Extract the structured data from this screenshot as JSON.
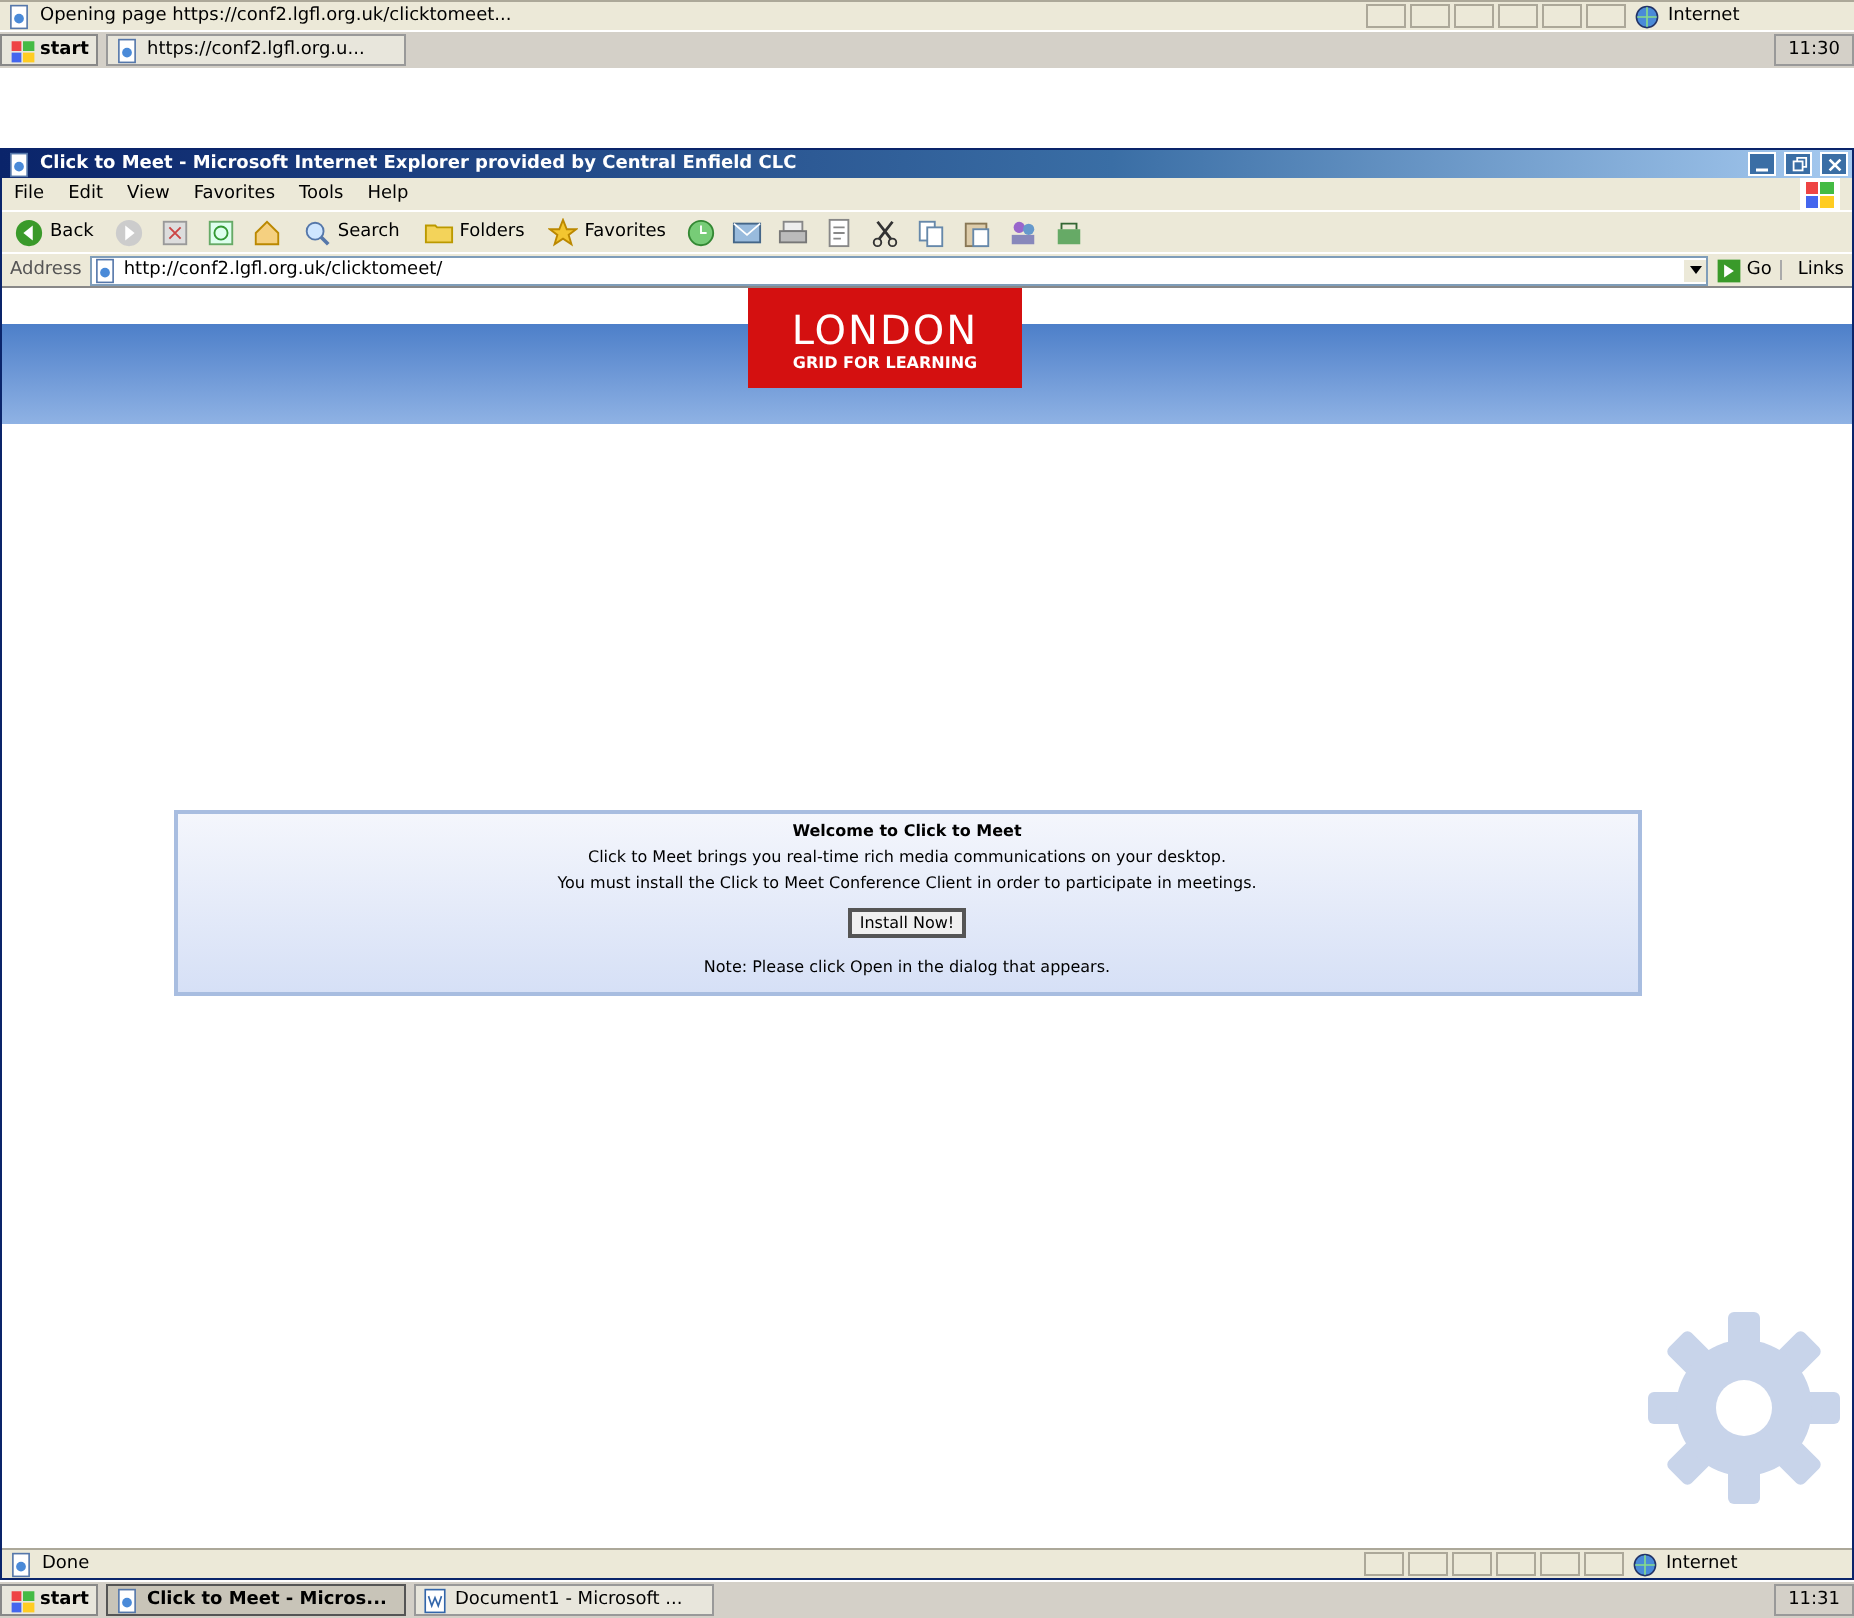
{
  "background_window": {
    "status_text": "Opening page https://conf2.lgfl.org.uk/clicktomeet...",
    "zone": "Internet",
    "taskbar": {
      "start": "start",
      "tasks": [
        {
          "label": "https://conf2.lgfl.org.u...",
          "selected": false
        }
      ],
      "clock": "11:30"
    }
  },
  "window": {
    "title": "Click to Meet - Microsoft Internet Explorer provided by Central Enfield CLC"
  },
  "menu": [
    "File",
    "Edit",
    "View",
    "Favorites",
    "Tools",
    "Help"
  ],
  "toolbar": [
    {
      "kind": "labeled",
      "label": "Back"
    },
    {
      "kind": "icon"
    },
    {
      "kind": "icon"
    },
    {
      "kind": "icon"
    },
    {
      "kind": "icon"
    },
    {
      "kind": "labeled",
      "label": "Search"
    },
    {
      "kind": "labeled",
      "label": "Folders"
    },
    {
      "kind": "labeled",
      "label": "Favorites"
    },
    {
      "kind": "icon"
    },
    {
      "kind": "icon"
    },
    {
      "kind": "icon"
    },
    {
      "kind": "icon"
    },
    {
      "kind": "icon"
    },
    {
      "kind": "icon"
    },
    {
      "kind": "icon"
    },
    {
      "kind": "icon"
    },
    {
      "kind": "icon"
    }
  ],
  "address": {
    "label": "Address",
    "value": "http://conf2.lgfl.org.uk/clicktomeet/",
    "go": "Go",
    "links": "Links"
  },
  "logo": {
    "title": "LONDON",
    "subtitle": "GRID FOR LEARNING"
  },
  "welcome": {
    "heading": "Welcome to Click to Meet",
    "lines": [
      "Click to Meet brings you real-time rich media communications on your desktop.",
      "You must install the Click to Meet Conference Client in order to participate in meetings."
    ],
    "button": "Install Now!",
    "note": "Note: Please click Open in the dialog that appears."
  },
  "status_bar": {
    "text": "Done",
    "zone": "Internet"
  },
  "taskbar": {
    "start": "start",
    "tasks": [
      {
        "label": "Click to Meet - Micros...",
        "selected": true
      },
      {
        "label": "Document1 - Microsoft ...",
        "selected": false
      }
    ],
    "clock": "11:31"
  }
}
